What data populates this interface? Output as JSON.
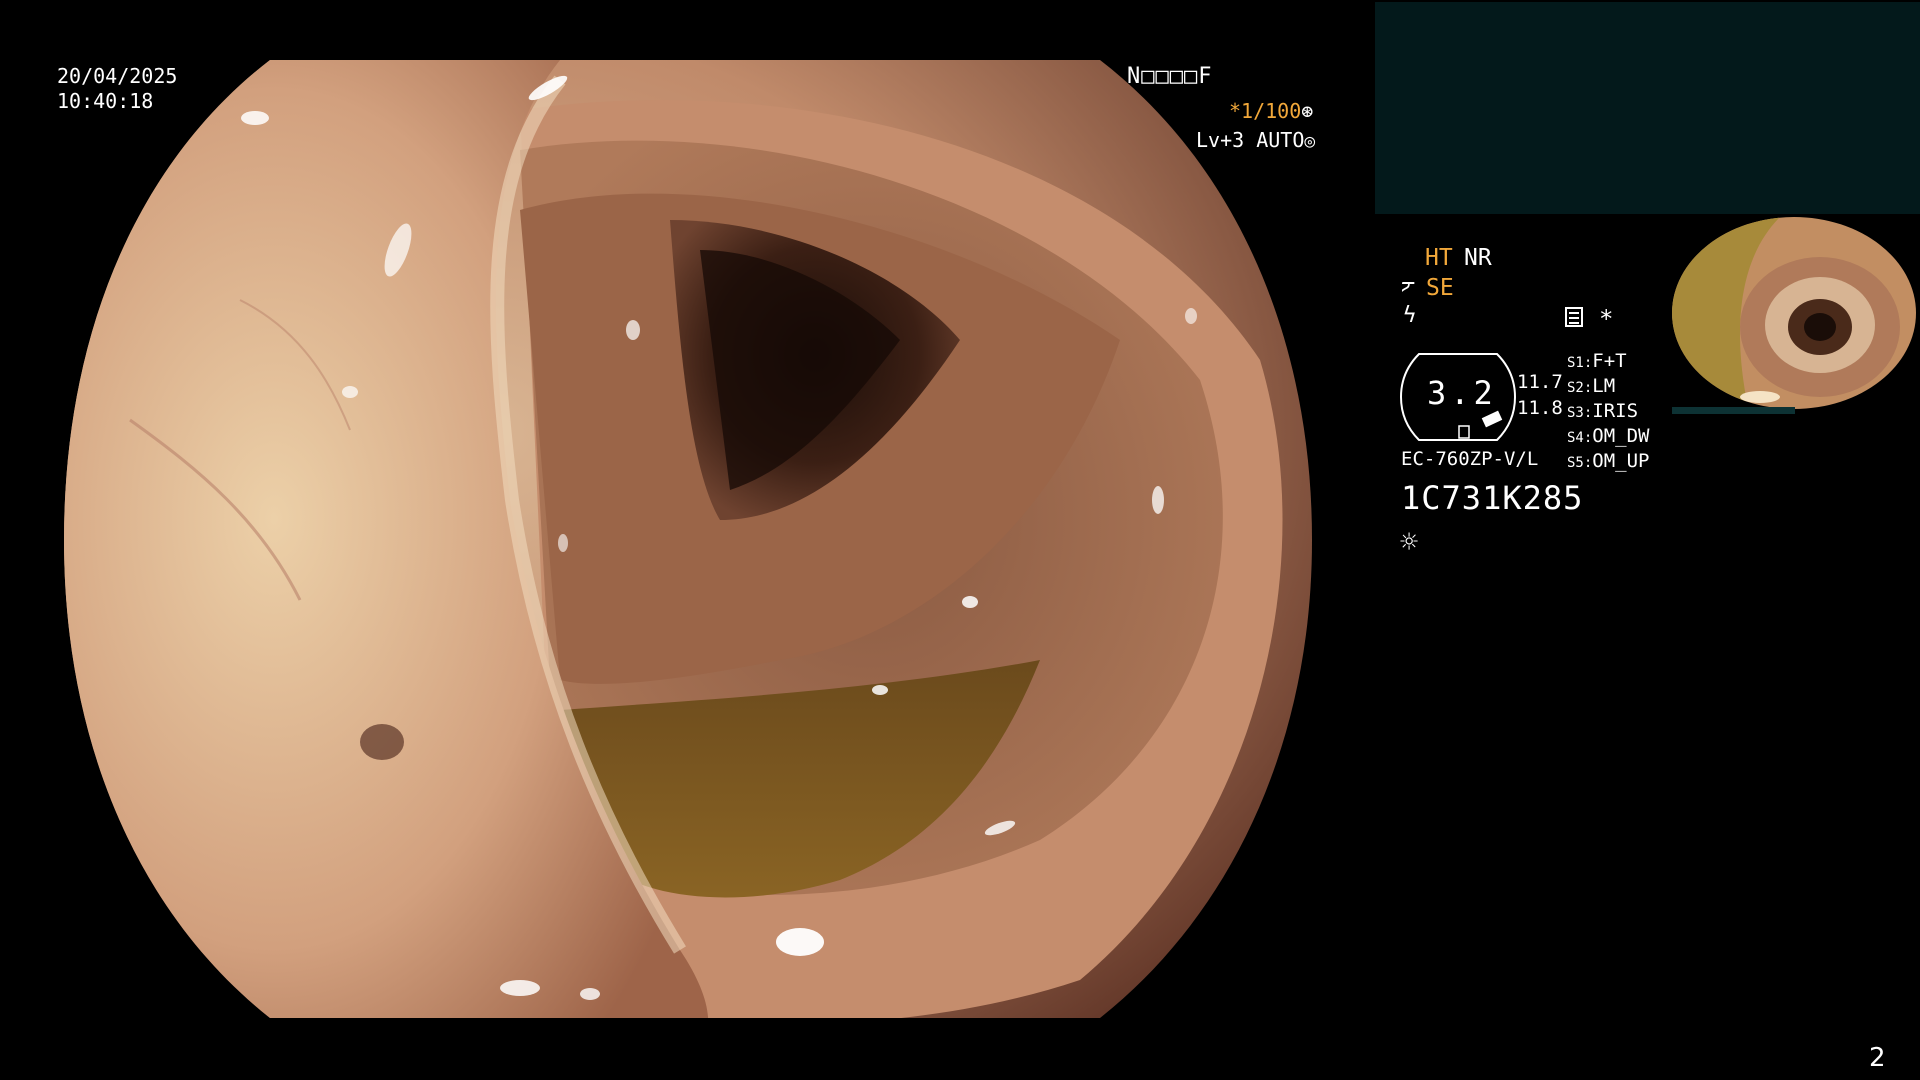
{
  "overlay": {
    "date": "20/04/2025",
    "time": "10:40:18",
    "patient_id": "N□□□□F",
    "shutter": "*1/100",
    "shutter_icon": "aperture-icon",
    "level": "Lv+3 AUTO",
    "level_icon": "target-icon"
  },
  "panel": {
    "ht": "HT",
    "nr": "NR",
    "se_icon": "scope-tip-icon",
    "se": "SE",
    "bolt_icon": "flash-icon",
    "memo_icon": "memo-icon",
    "star": "*",
    "zoom": "3.2",
    "value1": "11.7",
    "value2": "11.8",
    "model": "EC-760ZP-V/L",
    "serial": "1C731K285",
    "light_icon": "sun-icon",
    "switches": [
      {
        "key": "S1:",
        "value": "F+T"
      },
      {
        "key": "S2:",
        "value": "LM"
      },
      {
        "key": "S3:",
        "value": "IRIS"
      },
      {
        "key": "S4:",
        "value": "OM_DW"
      },
      {
        "key": "S5:",
        "value": "OM_UP"
      }
    ]
  },
  "footer": {
    "page_number": "2"
  },
  "colors": {
    "accent_orange": "#f2a83a",
    "panel_box": "#03191b"
  }
}
